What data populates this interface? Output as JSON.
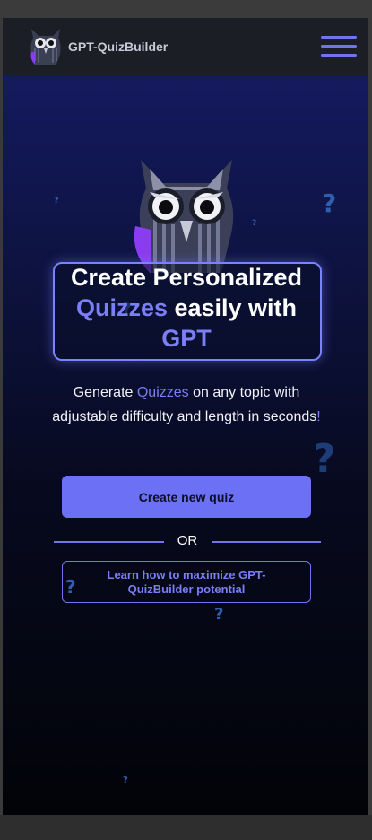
{
  "header": {
    "brand": "GPT-QuizBuilder",
    "logo_icon": "owl-logo-icon",
    "menu_icon": "hamburger-menu-icon"
  },
  "hero": {
    "headline_line1": "Create Personalized",
    "headline_accent": "Quizzes",
    "headline_line2_rest": " easily with",
    "headline_line3": "GPT",
    "subtitle_part1": "Generate ",
    "subtitle_accent": "Quizzes",
    "subtitle_part2": " on any topic with adjustable difficulty and length in seconds",
    "subtitle_end": "!",
    "owl_icon": "owl-mascot-icon",
    "decor_icon": "question-mark-icon"
  },
  "actions": {
    "create_label": "Create new quiz",
    "divider_label": "OR",
    "learn_label": "Learn how to maximize GPT-QuizBuilder potential"
  },
  "colors": {
    "accent": "#6c70f4",
    "header_bg": "#1c1e26",
    "hero_top": "#141a5e",
    "hero_bottom": "#020308"
  }
}
